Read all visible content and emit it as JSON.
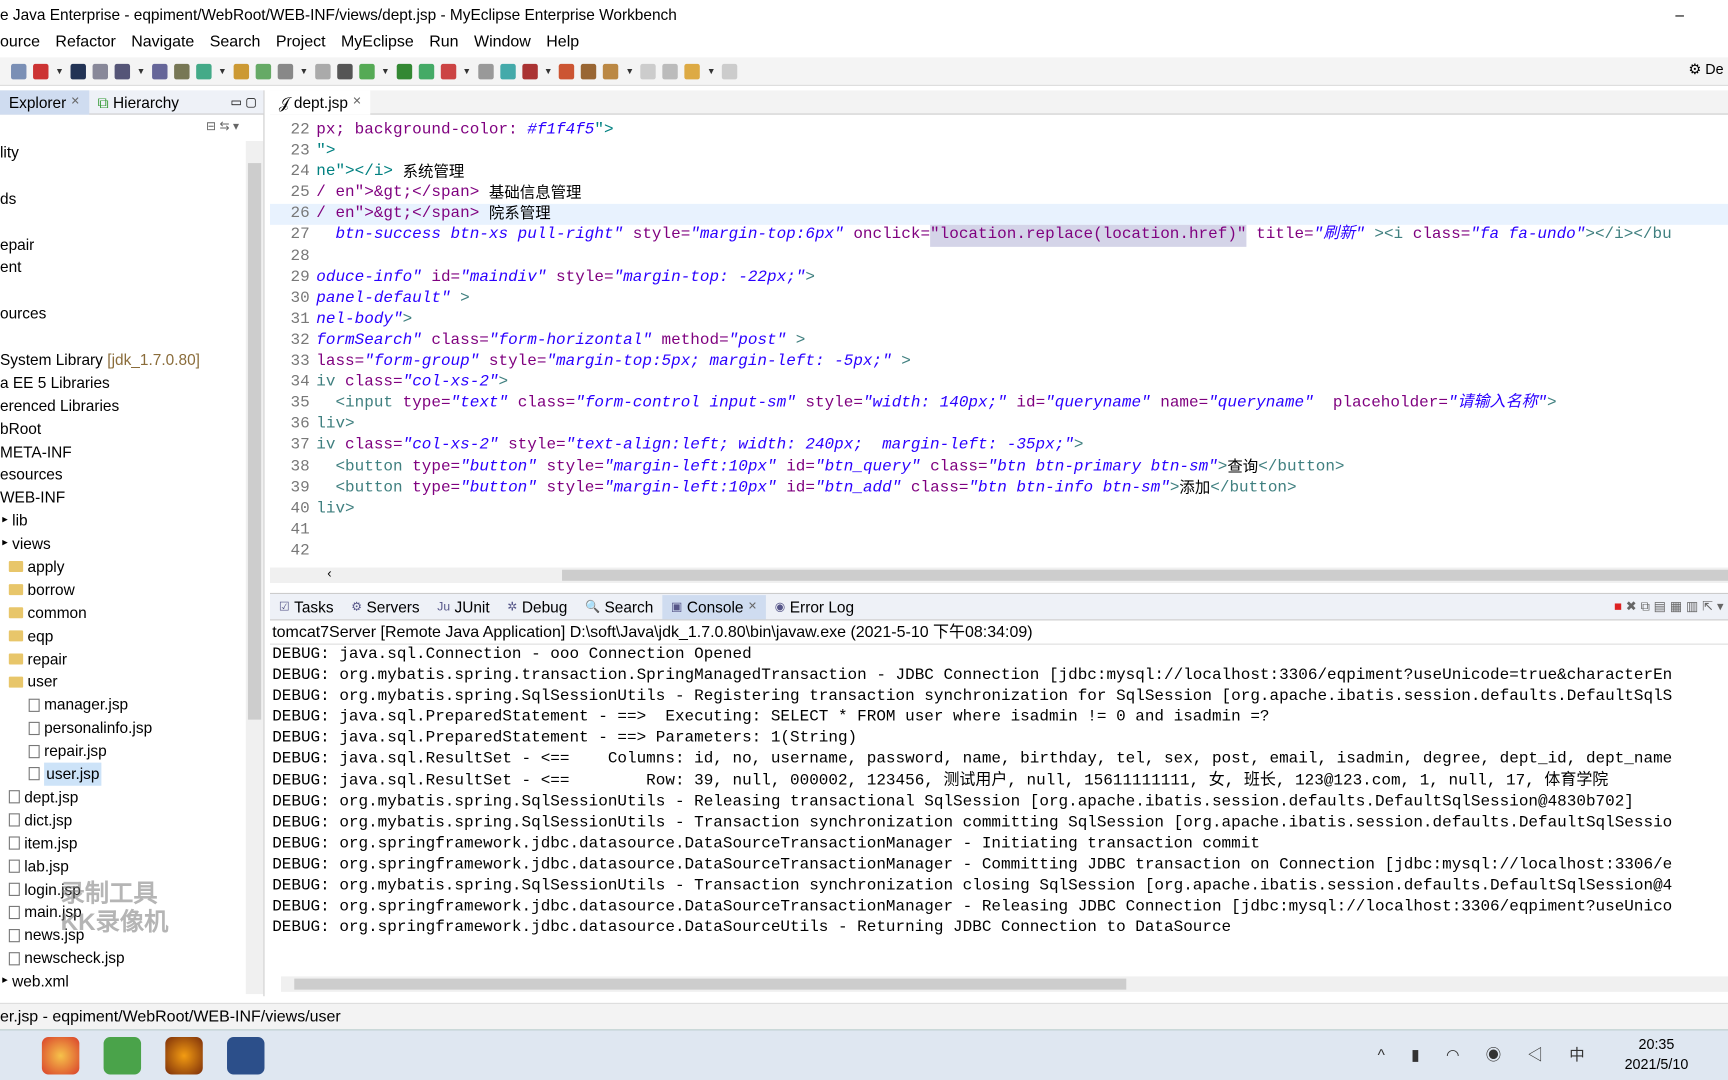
{
  "window": {
    "title": "e Java Enterprise - eqpiment/WebRoot/WEB-INF/views/dept.jsp - MyEclipse Enterprise Workbench",
    "minimize": "–"
  },
  "menu": [
    "ource",
    "Refactor",
    "Navigate",
    "Search",
    "Project",
    "MyEclipse",
    "Run",
    "Window",
    "Help"
  ],
  "perspective": "De",
  "left_tabs": [
    {
      "label": "Explorer",
      "active": true
    },
    {
      "label": "Hierarchy",
      "active": false
    }
  ],
  "tree": [
    {
      "label": "lity",
      "lvl": 0,
      "kind": "none"
    },
    {
      "label": "",
      "lvl": 0,
      "kind": "none"
    },
    {
      "label": "ds",
      "lvl": 0,
      "kind": "none"
    },
    {
      "label": "",
      "lvl": 0,
      "kind": "none"
    },
    {
      "label": "epair",
      "lvl": 0,
      "kind": "none"
    },
    {
      "label": "ent",
      "lvl": 0,
      "kind": "none"
    },
    {
      "label": "",
      "lvl": 0,
      "kind": "none"
    },
    {
      "label": "ources",
      "lvl": 0,
      "kind": "none"
    },
    {
      "label": "",
      "lvl": 0,
      "kind": "none"
    },
    {
      "label": "System Library",
      "extra": "[jdk_1.7.0.80]",
      "lvl": 0,
      "kind": "none"
    },
    {
      "label": "a EE 5 Libraries",
      "lvl": 0,
      "kind": "none"
    },
    {
      "label": "erenced Libraries",
      "lvl": 0,
      "kind": "none"
    },
    {
      "label": "bRoot",
      "lvl": 0,
      "kind": "none"
    },
    {
      "label": "META-INF",
      "lvl": 0,
      "kind": "none"
    },
    {
      "label": "esources",
      "lvl": 0,
      "kind": "none"
    },
    {
      "label": "WEB-INF",
      "lvl": 0,
      "kind": "none"
    },
    {
      "label": "lib",
      "lvl": 1,
      "kind": "none"
    },
    {
      "label": "views",
      "lvl": 1,
      "kind": "none"
    },
    {
      "label": "apply",
      "lvl": 2,
      "kind": "folder"
    },
    {
      "label": "borrow",
      "lvl": 2,
      "kind": "folder"
    },
    {
      "label": "common",
      "lvl": 2,
      "kind": "folder"
    },
    {
      "label": "eqp",
      "lvl": 2,
      "kind": "folder"
    },
    {
      "label": "repair",
      "lvl": 2,
      "kind": "folder"
    },
    {
      "label": "user",
      "lvl": 2,
      "kind": "folder"
    },
    {
      "label": "manager.jsp",
      "lvl": 3,
      "kind": "file"
    },
    {
      "label": "personalinfo.jsp",
      "lvl": 3,
      "kind": "file"
    },
    {
      "label": "repair.jsp",
      "lvl": 3,
      "kind": "file"
    },
    {
      "label": "user.jsp",
      "lvl": 3,
      "kind": "file",
      "selected": true
    },
    {
      "label": "dept.jsp",
      "lvl": 2,
      "kind": "file"
    },
    {
      "label": "dict.jsp",
      "lvl": 2,
      "kind": "file"
    },
    {
      "label": "item.jsp",
      "lvl": 2,
      "kind": "file"
    },
    {
      "label": "lab.jsp",
      "lvl": 2,
      "kind": "file"
    },
    {
      "label": "login.jsp",
      "lvl": 2,
      "kind": "file"
    },
    {
      "label": "main.jsp",
      "lvl": 2,
      "kind": "file"
    },
    {
      "label": "news.jsp",
      "lvl": 2,
      "kind": "file"
    },
    {
      "label": "newscheck.jsp",
      "lvl": 2,
      "kind": "file"
    },
    {
      "label": "web.xml",
      "lvl": 1,
      "kind": "none"
    }
  ],
  "editor": {
    "tab": "dept.jsp",
    "lines": [
      {
        "n": "22",
        "segs": [
          [
            "attr",
            "px; background-color: "
          ],
          [
            "str",
            "#f1f4f5"
          ],
          [
            "plain",
            "\">"
          ]
        ]
      },
      {
        "n": "23",
        "segs": [
          [
            "plain",
            "\">"
          ]
        ]
      },
      {
        "n": "24",
        "segs": [
          [
            "plain",
            "ne\"></i> "
          ],
          [
            "txt",
            "系统管理"
          ]
        ]
      },
      {
        "n": "25",
        "segs": [
          [
            "attr",
            "/ en\">&gt;</span> "
          ],
          [
            "txt",
            "基础信息管理"
          ]
        ]
      },
      {
        "n": "26",
        "cur": true,
        "segs": [
          [
            "attr",
            "/ en\">&gt;</span> "
          ],
          [
            "txt",
            "院系管理"
          ]
        ]
      },
      {
        "n": "27",
        "segs": [
          [
            "str",
            "  btn-success btn-xs pull-right\""
          ],
          [
            "attr",
            " style="
          ],
          [
            "str",
            "\"margin-top:6px\""
          ],
          [
            "attr",
            " onclick="
          ],
          [
            "hl",
            "\"location.replace(location.href)\""
          ],
          [
            "attr",
            " title="
          ],
          [
            "str",
            "\"刷新\""
          ],
          [
            "tag",
            " ><i "
          ],
          [
            "attr",
            "class="
          ],
          [
            "str",
            "\"fa fa-undo\""
          ],
          [
            "tag",
            "></i></bu"
          ]
        ]
      },
      {
        "n": "28",
        "segs": []
      },
      {
        "n": "29",
        "segs": [
          [
            "str",
            "oduce-info\""
          ],
          [
            "attr",
            " id="
          ],
          [
            "str",
            "\"maindiv\""
          ],
          [
            "attr",
            " style="
          ],
          [
            "str",
            "\"margin-top: -22px;\""
          ],
          [
            "tag",
            ">"
          ]
        ]
      },
      {
        "n": "30",
        "segs": [
          [
            "str",
            "panel-default\""
          ],
          [
            "tag",
            " >"
          ]
        ]
      },
      {
        "n": "31",
        "segs": [
          [
            "str",
            "nel-body\""
          ],
          [
            "tag",
            ">"
          ]
        ]
      },
      {
        "n": "32",
        "segs": [
          [
            "str",
            "formSearch\""
          ],
          [
            "attr",
            " class="
          ],
          [
            "str",
            "\"form-horizontal\""
          ],
          [
            "attr",
            " method="
          ],
          [
            "str",
            "\"post\""
          ],
          [
            "tag",
            " >"
          ]
        ]
      },
      {
        "n": "33",
        "segs": [
          [
            "attr",
            "lass="
          ],
          [
            "str",
            "\"form-group\""
          ],
          [
            "attr",
            " style="
          ],
          [
            "str",
            "\"margin-top:5px; margin-left: -5px;\""
          ],
          [
            "tag",
            " >"
          ]
        ]
      },
      {
        "n": "34",
        "segs": [
          [
            "tag",
            "iv "
          ],
          [
            "attr",
            "class="
          ],
          [
            "str",
            "\"col-xs-2\""
          ],
          [
            "tag",
            ">"
          ]
        ]
      },
      {
        "n": "35",
        "segs": [
          [
            "tag",
            "  <input "
          ],
          [
            "attr",
            "type="
          ],
          [
            "str",
            "\"text\""
          ],
          [
            "attr",
            " class="
          ],
          [
            "str",
            "\"form-control input-sm\""
          ],
          [
            "attr",
            " style="
          ],
          [
            "str",
            "\"width: 140px;\""
          ],
          [
            "attr",
            " id="
          ],
          [
            "str",
            "\"queryname\""
          ],
          [
            "attr",
            " name="
          ],
          [
            "str",
            "\"queryname\""
          ],
          [
            "attr",
            "  placeholder="
          ],
          [
            "str",
            "\"请输入名称\""
          ],
          [
            "tag",
            ">"
          ]
        ]
      },
      {
        "n": "36",
        "segs": [
          [
            "tag",
            "liv>"
          ]
        ]
      },
      {
        "n": "37",
        "segs": [
          [
            "tag",
            "iv "
          ],
          [
            "attr",
            "class="
          ],
          [
            "str",
            "\"col-xs-2\""
          ],
          [
            "attr",
            " style="
          ],
          [
            "str",
            "\"text-align:left; width: 240px;  margin-left: -35px;\""
          ],
          [
            "tag",
            ">"
          ]
        ]
      },
      {
        "n": "38",
        "segs": [
          [
            "tag",
            "  <button "
          ],
          [
            "attr",
            "type="
          ],
          [
            "str",
            "\"button\""
          ],
          [
            "attr",
            " style="
          ],
          [
            "str",
            "\"margin-left:10px\""
          ],
          [
            "attr",
            " id="
          ],
          [
            "str",
            "\"btn_query\""
          ],
          [
            "attr",
            " class="
          ],
          [
            "str",
            "\"btn btn-primary btn-sm\""
          ],
          [
            "tag",
            ">"
          ],
          [
            "txt",
            "查询"
          ],
          [
            "tag",
            "</button>"
          ]
        ]
      },
      {
        "n": "39",
        "segs": [
          [
            "tag",
            "  <button "
          ],
          [
            "attr",
            "type="
          ],
          [
            "str",
            "\"button\""
          ],
          [
            "attr",
            " style="
          ],
          [
            "str",
            "\"margin-left:10px\""
          ],
          [
            "attr",
            " id="
          ],
          [
            "str",
            "\"btn_add\""
          ],
          [
            "attr",
            " class="
          ],
          [
            "str",
            "\"btn btn-info btn-sm\""
          ],
          [
            "tag",
            ">"
          ],
          [
            "txt",
            "添加"
          ],
          [
            "tag",
            "</button>"
          ]
        ]
      },
      {
        "n": "40",
        "segs": [
          [
            "tag",
            "liv>"
          ]
        ]
      },
      {
        "n": "41",
        "segs": []
      },
      {
        "n": "42",
        "segs": []
      }
    ]
  },
  "console": {
    "tabs": [
      "Tasks",
      "Servers",
      "JUnit",
      "Debug",
      "Search",
      "Console",
      "Error Log"
    ],
    "active_tab": "Console",
    "header": "tomcat7Server [Remote Java Application] D:\\soft\\Java\\jdk_1.7.0.80\\bin\\javaw.exe (2021-5-10 下午08:34:09)",
    "lines": [
      "DEBUG: java.sql.Connection - ooo Connection Opened",
      "DEBUG: org.mybatis.spring.transaction.SpringManagedTransaction - JDBC Connection [jdbc:mysql://localhost:3306/eqpiment?useUnicode=true&characterEn",
      "DEBUG: org.mybatis.spring.SqlSessionUtils - Registering transaction synchronization for SqlSession [org.apache.ibatis.session.defaults.DefaultSqlS",
      "DEBUG: java.sql.PreparedStatement - ==>  Executing: SELECT * FROM user where isadmin != 0 and isadmin =?",
      "DEBUG: java.sql.PreparedStatement - ==> Parameters: 1(String)",
      "DEBUG: java.sql.ResultSet - <==    Columns: id, no, username, password, name, birthday, tel, sex, post, email, isadmin, degree, dept_id, dept_name",
      "DEBUG: java.sql.ResultSet - <==        Row: 39, null, 000002, 123456, 测试用户, null, 15611111111, 女, 班长, 123@123.com, 1, null, 17, 体育学院",
      "DEBUG: org.mybatis.spring.SqlSessionUtils - Releasing transactional SqlSession [org.apache.ibatis.session.defaults.DefaultSqlSession@4830b702]",
      "DEBUG: org.mybatis.spring.SqlSessionUtils - Transaction synchronization committing SqlSession [org.apache.ibatis.session.defaults.DefaultSqlSessio",
      "DEBUG: org.springframework.jdbc.datasource.DataSourceTransactionManager - Initiating transaction commit",
      "DEBUG: org.springframework.jdbc.datasource.DataSourceTransactionManager - Committing JDBC transaction on Connection [jdbc:mysql://localhost:3306/e",
      "DEBUG: org.mybatis.spring.SqlSessionUtils - Transaction synchronization closing SqlSession [org.apache.ibatis.session.defaults.DefaultSqlSession@4",
      "DEBUG: org.springframework.jdbc.datasource.DataSourceTransactionManager - Releasing JDBC Connection [jdbc:mysql://localhost:3306/eqpiment?useUnico",
      "DEBUG: org.springframework.jdbc.datasource.DataSourceUtils - Returning JDBC Connection to DataSource"
    ]
  },
  "status": "er.jsp - eqpiment/WebRoot/WEB-INF/views/user",
  "watermark": "录制工具 KK录像机",
  "taskbar": {
    "time": "20:35",
    "date": "2021/5/10",
    "ime": "中"
  },
  "colors": {
    "tag": "#3f7f7f",
    "attr": "#7f007f",
    "string": "#2a00ff",
    "current_line": "#e8f2fe"
  }
}
